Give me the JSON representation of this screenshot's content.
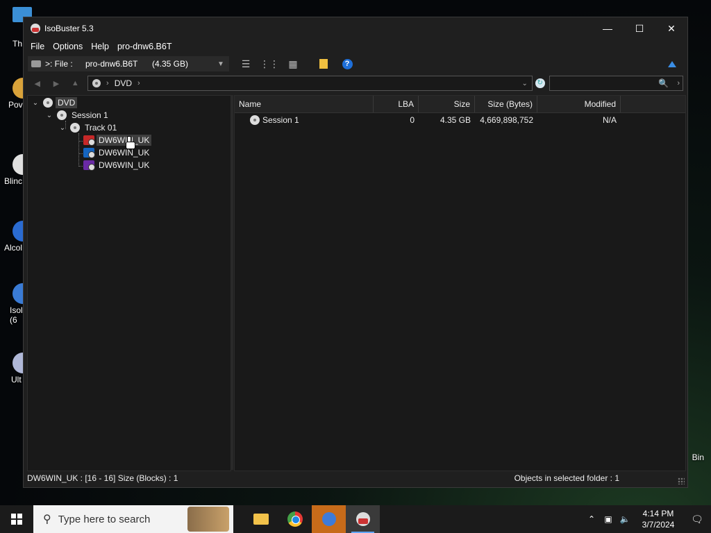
{
  "desktop": {
    "icons": [
      {
        "label": "Th",
        "top": 0
      },
      {
        "label": "Pov",
        "top": 0
      },
      {
        "label": "Blinc",
        "top": 0
      },
      {
        "label": "Alcol",
        "top": 0
      },
      {
        "label": "Isol\n(6",
        "top": 0
      },
      {
        "label": "Ult",
        "top": 0
      }
    ],
    "recycle_label": "Bin"
  },
  "window": {
    "title": "IsoBuster 5.3",
    "controls": {
      "minimize": "—",
      "maximize": "☐",
      "close": "✕"
    }
  },
  "menu": [
    "File",
    "Options",
    "Help",
    "pro-dnw6.B6T"
  ],
  "toolbar": {
    "drive_prefix": ">: File :",
    "drive_name": "pro-dnw6.B6T",
    "drive_size": "(4.35 GB)",
    "help_label": "?"
  },
  "navbar": {
    "crumb": "DVD",
    "search_placeholder": ""
  },
  "tree": {
    "root": "DVD",
    "session": "Session 1",
    "track": "Track 01",
    "filesystems": [
      "DW6WIN_UK",
      "DW6WIN_UK",
      "DW6WIN_UK"
    ]
  },
  "list": {
    "columns": [
      "Name",
      "LBA",
      "Size",
      "Size (Bytes)",
      "Modified"
    ],
    "rows": [
      {
        "name": "Session 1",
        "lba": "0",
        "size": "4.35 GB",
        "bytes": "4,669,898,752",
        "modified": "N/A"
      }
    ]
  },
  "status": {
    "left": "DW6WIN_UK : [16 - 16]  Size (Blocks) : 1",
    "right": "Objects in selected folder : 1"
  },
  "taskbar": {
    "search_placeholder": "Type here to search",
    "time": "4:14 PM",
    "date": "3/7/2024"
  }
}
